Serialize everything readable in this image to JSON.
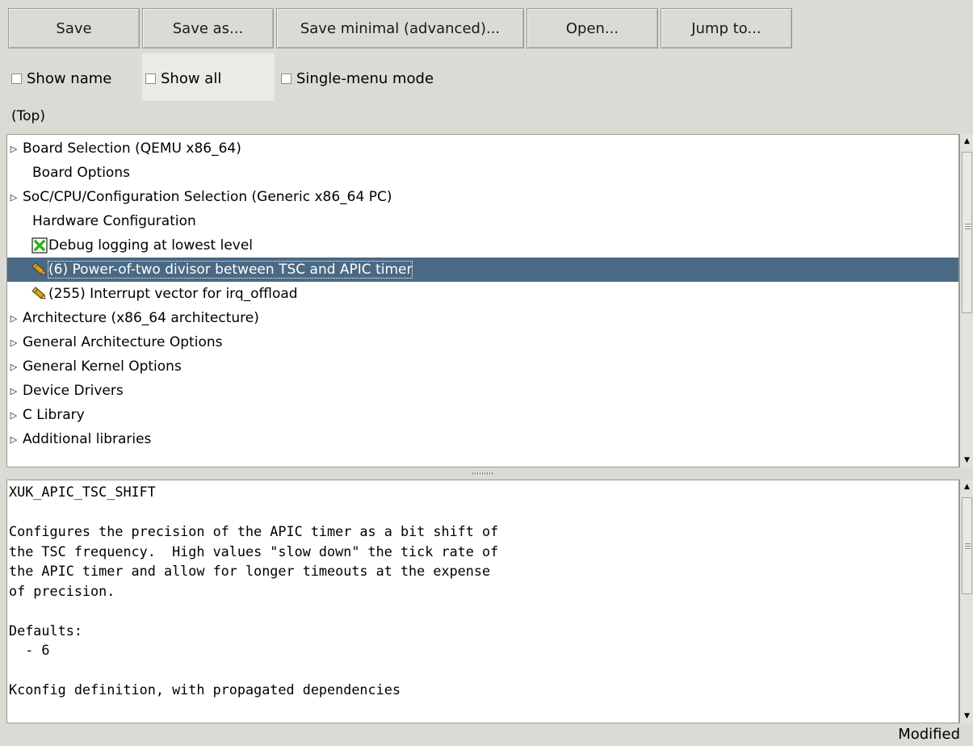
{
  "toolbar": {
    "save": "Save",
    "save_as": "Save as...",
    "save_minimal": "Save minimal (advanced)...",
    "open": "Open...",
    "jump_to": "Jump to..."
  },
  "options": {
    "show_name": {
      "label": "Show name",
      "checked": false
    },
    "show_all": {
      "label": "Show all",
      "checked": false
    },
    "single_menu": {
      "label": "Single-menu mode",
      "checked": false
    }
  },
  "breadcrumb": "(Top)",
  "tree": {
    "items": [
      {
        "label": "Board Selection (QEMU x86_64)",
        "icon": "expand-triangle-icon"
      },
      {
        "label": "Board Options",
        "icon": "none"
      },
      {
        "label": "SoC/CPU/Configuration Selection (Generic x86_64 PC)",
        "icon": "expand-triangle-icon"
      },
      {
        "label": "Hardware Configuration",
        "icon": "none"
      },
      {
        "label": "Debug logging at lowest level",
        "icon": "checked-box-icon"
      },
      {
        "label": "(6) Power-of-two divisor between TSC and APIC timer",
        "icon": "pencil-icon",
        "selected": true
      },
      {
        "label": "(255) Interrupt vector for irq_offload",
        "icon": "pencil-icon"
      },
      {
        "label": "Architecture (x86_64 architecture)",
        "icon": "expand-triangle-icon"
      },
      {
        "label": "General Architecture Options",
        "icon": "expand-triangle-icon"
      },
      {
        "label": "General Kernel Options",
        "icon": "expand-triangle-icon"
      },
      {
        "label": "Device Drivers",
        "icon": "expand-triangle-icon"
      },
      {
        "label": "C Library",
        "icon": "expand-triangle-icon"
      },
      {
        "label": "Additional libraries",
        "icon": "expand-triangle-icon"
      }
    ]
  },
  "info": {
    "text": "XUK_APIC_TSC_SHIFT\n\nConfigures the precision of the APIC timer as a bit shift of\nthe TSC frequency.  High values \"slow down\" the tick rate of\nthe APIC timer and allow for longer timeouts at the expense\nof precision.\n\nDefaults:\n  - 6\n\nKconfig definition, with propagated dependencies"
  },
  "status": "Modified",
  "colors": {
    "background": "#dcdad5",
    "selection": "#4a6984",
    "check_green": "#2db31f",
    "pencil_gold": "#d4a017"
  }
}
